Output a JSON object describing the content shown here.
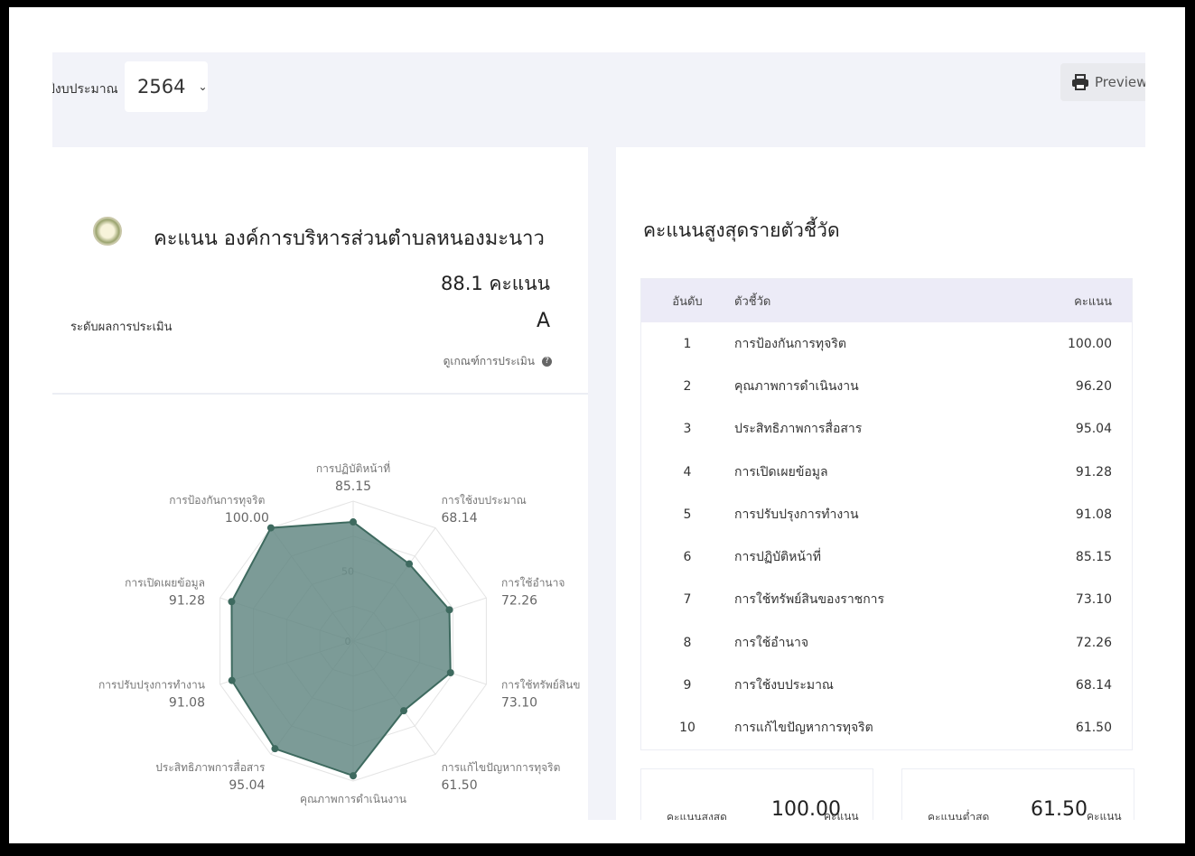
{
  "filter": {
    "year_label": "ปีงบประมาณ",
    "year_value": "2564"
  },
  "toolbar": {
    "preview_label": "Preview"
  },
  "summary": {
    "title": "คะแนน องค์การบริหารส่วนตำบลหนองมะนาว",
    "score": "88.1 คะแนน",
    "grade_label": "ระดับผลการประเมิน",
    "grade": "A",
    "criteria_link": "ดูเกณฑ์การประเมิน"
  },
  "chart_data": {
    "type": "radar",
    "title": "",
    "rlim": [
      0,
      100
    ],
    "ticks": [
      "0",
      "50"
    ],
    "axes": [
      {
        "label": "การปฏิบัติหน้าที่",
        "value": 85.15,
        "value_label": "85.15"
      },
      {
        "label": "การใช้งบประมาณ",
        "value": 68.14,
        "value_label": "68.14"
      },
      {
        "label": "การใช้อำนาจ",
        "value": 72.26,
        "value_label": "72.26"
      },
      {
        "label": "การใช้ทรัพย์สินข",
        "value": 73.1,
        "value_label": "73.10"
      },
      {
        "label": "การแก้ไขปัญหาการทุจริต",
        "value": 61.5,
        "value_label": "61.50"
      },
      {
        "label": "คุณภาพการดำเนินงาน",
        "value": 96.2,
        "value_label": ""
      },
      {
        "label": "ประสิทธิภาพการสื่อสาร",
        "value": 95.04,
        "value_label": "95.04"
      },
      {
        "label": "การปรับปรุงการทำงาน",
        "value": 91.08,
        "value_label": "91.08"
      },
      {
        "label": "การเปิดเผยข้อมูล",
        "value": 91.28,
        "value_label": "91.28"
      },
      {
        "label": "การป้องกันการทุจริต",
        "value": 100.0,
        "value_label": "100.00"
      }
    ],
    "colors": {
      "fill": "#5f8580",
      "stroke": "#3e6a5f",
      "grid": "#e4e4e4"
    }
  },
  "ranking": {
    "title": "คะแนนสูงสุดรายตัวชี้วัด",
    "headers": [
      "อันดับ",
      "ตัวชี้วัด",
      "คะแนน"
    ],
    "rows": [
      {
        "rank": "1",
        "name": "การป้องกันการทุจริต",
        "score": "100.00"
      },
      {
        "rank": "2",
        "name": "คุณภาพการดำเนินงาน",
        "score": "96.20"
      },
      {
        "rank": "3",
        "name": "ประสิทธิภาพการสื่อสาร",
        "score": "95.04"
      },
      {
        "rank": "4",
        "name": "การเปิดเผยข้อมูล",
        "score": "91.28"
      },
      {
        "rank": "5",
        "name": "การปรับปรุงการทำงาน",
        "score": "91.08"
      },
      {
        "rank": "6",
        "name": "การปฏิบัติหน้าที่",
        "score": "85.15"
      },
      {
        "rank": "7",
        "name": "การใช้ทรัพย์สินของราชการ",
        "score": "73.10"
      },
      {
        "rank": "8",
        "name": "การใช้อำนาจ",
        "score": "72.26"
      },
      {
        "rank": "9",
        "name": "การใช้งบประมาณ",
        "score": "68.14"
      },
      {
        "rank": "10",
        "name": "การแก้ไขปัญหาการทุจริต",
        "score": "61.50"
      }
    ]
  },
  "stats": {
    "max_label": "คะแนนสูงสุด",
    "max_value": "100.00",
    "max_unit": "คะแนน",
    "min_label": "คะแนนต่ำสุด",
    "min_value": "61.50",
    "min_unit": "คะแนน"
  }
}
